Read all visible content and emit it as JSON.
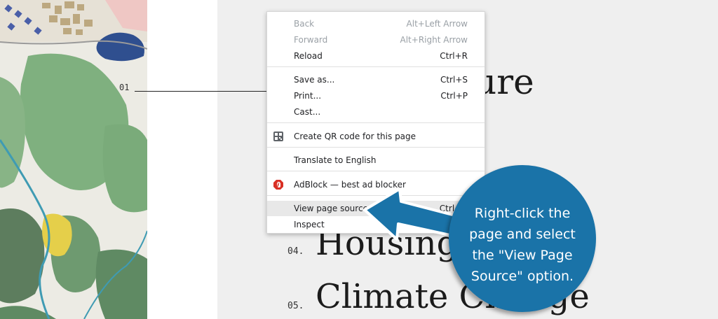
{
  "map": {
    "marker_label": "01"
  },
  "headings": [
    {
      "number": "",
      "text": "ure"
    },
    {
      "number": "04.",
      "text": "Housing"
    },
    {
      "number": "05.",
      "text": "Climate Change"
    }
  ],
  "context_menu": {
    "items": [
      {
        "label": "Back",
        "shortcut": "Alt+Left Arrow"
      },
      {
        "label": "Forward",
        "shortcut": "Alt+Right Arrow"
      },
      {
        "label": "Reload",
        "shortcut": "Ctrl+R"
      },
      {
        "label": "Save as...",
        "shortcut": "Ctrl+S"
      },
      {
        "label": "Print...",
        "shortcut": "Ctrl+P"
      },
      {
        "label": "Cast...",
        "shortcut": ""
      },
      {
        "label": "Create QR code for this page",
        "shortcut": "",
        "icon": "qr-code-icon"
      },
      {
        "label": "Translate to English",
        "shortcut": ""
      },
      {
        "label": "AdBlock — best ad blocker",
        "shortcut": "",
        "icon": "adblock-icon"
      },
      {
        "label": "View page source",
        "shortcut": "Ctrl+U"
      },
      {
        "label": "Inspect",
        "shortcut": ""
      }
    ]
  },
  "callout": {
    "line1": "Right-click the",
    "line2": "page and select",
    "line3": "the \"View Page",
    "line4": "Source\" option.",
    "color": "#1a73a8"
  }
}
